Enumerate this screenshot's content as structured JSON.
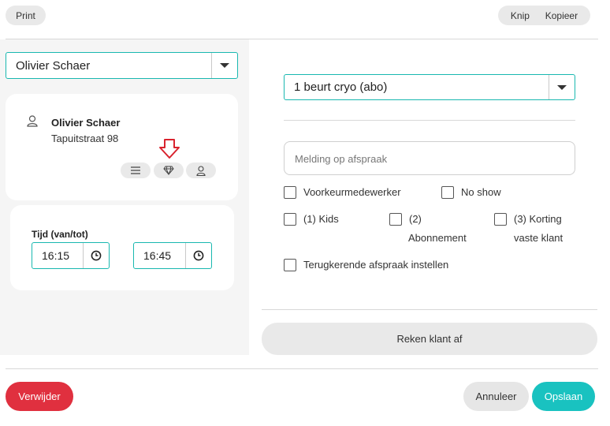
{
  "toolbar": {
    "print_label": "Print",
    "cut_label": "Knip",
    "copy_label": "Kopieer"
  },
  "client_select": {
    "value": "Olivier Schaer"
  },
  "client_card": {
    "name": "Olivier Schaer",
    "address": "Tapuitstraat 98"
  },
  "time": {
    "label": "Tijd (van/tot)",
    "from": "16:15",
    "to": "16:45"
  },
  "treatment_select": {
    "value": "1 beurt cryo (abo)"
  },
  "notes": {
    "placeholder": "Melding op afspraak"
  },
  "checkboxes": {
    "preferred_employee": "Voorkeurmedewerker",
    "no_show": "No show",
    "kids": "(1) Kids",
    "subscription_a": "(2)",
    "subscription_b": "Abonnement",
    "discount_a": "(3) Korting",
    "discount_b": "vaste klant",
    "recurring": "Terugkerende afspraak instellen"
  },
  "checkout_label": "Reken klant af",
  "footer": {
    "delete_label": "Verwijder",
    "cancel_label": "Annuleer",
    "save_label": "Opslaan"
  },
  "colors": {
    "accent": "#19c2c0",
    "danger": "#e0303f",
    "highlight_arrow": "#d9232e"
  }
}
